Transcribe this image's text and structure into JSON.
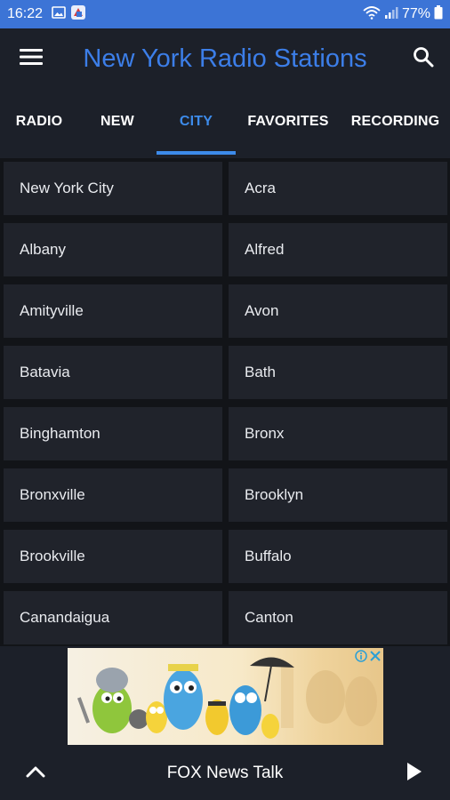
{
  "status_bar": {
    "time": "16:22",
    "battery": "77%",
    "icons": [
      "gallery-icon",
      "app-notification-icon",
      "wifi-icon",
      "signal-icon",
      "battery-icon"
    ]
  },
  "app_bar": {
    "title": "New York Radio Stations",
    "menu_icon": "hamburger-menu-icon",
    "search_icon": "search-icon",
    "title_color": "#3c7ee8"
  },
  "tabs": [
    {
      "label": "RADIO",
      "active": false
    },
    {
      "label": "NEW",
      "active": false
    },
    {
      "label": "CITY",
      "active": true
    },
    {
      "label": "FAVORITES",
      "active": false
    },
    {
      "label": "RECORDING",
      "active": false
    }
  ],
  "cities": [
    "New York City",
    "Acra",
    "Albany",
    "Alfred",
    "Amityville",
    "Avon",
    "Batavia",
    "Bath",
    "Binghamton",
    "Bronx",
    "Bronxville",
    "Brooklyn",
    "Brookville",
    "Buffalo",
    "Canandaigua",
    "Canton"
  ],
  "ad": {
    "icons": [
      "adchoices-icon",
      "close-icon"
    ]
  },
  "player": {
    "now_playing": "FOX News Talk",
    "expand_icon": "chevron-up-icon",
    "play_icon": "play-icon"
  },
  "colors": {
    "accent": "#3d8bea",
    "status_bar": "#3c74d6",
    "background": "#1c2029",
    "cell": "#20232b"
  }
}
